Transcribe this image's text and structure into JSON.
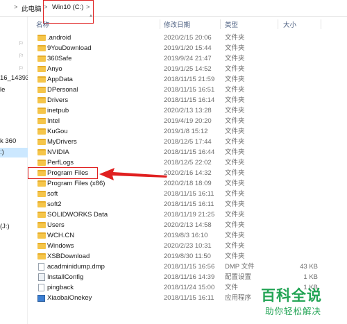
{
  "breadcrumb": {
    "chevron_left": ">",
    "computer": "此电脑",
    "chevron_mid": ">",
    "drive": "Win10 (C:)",
    "chevron_right": ">"
  },
  "nav": {
    "items": [
      {
        "label": "16_14393."
      },
      {
        "label": "le"
      },
      {
        "label": "k 360"
      },
      {
        "label": ":)"
      },
      {
        "label": "(J:)"
      }
    ]
  },
  "columns": {
    "name": "名称",
    "date": "修改日期",
    "type": "类型",
    "size": "大小"
  },
  "files": [
    {
      "name": ".android",
      "date": "2020/2/15 20:06",
      "type": "文件夹",
      "size": "",
      "icon": "folder-icon"
    },
    {
      "name": "9YouDownload",
      "date": "2019/1/20 15:44",
      "type": "文件夹",
      "size": "",
      "icon": "folder-icon"
    },
    {
      "name": "360Safe",
      "date": "2019/9/24 21:47",
      "type": "文件夹",
      "size": "",
      "icon": "folder-icon"
    },
    {
      "name": "Anyo",
      "date": "2019/1/25 14:52",
      "type": "文件夹",
      "size": "",
      "icon": "folder-icon"
    },
    {
      "name": "AppData",
      "date": "2018/11/15 21:59",
      "type": "文件夹",
      "size": "",
      "icon": "folder-icon"
    },
    {
      "name": "DPersonal",
      "date": "2018/11/15 16:51",
      "type": "文件夹",
      "size": "",
      "icon": "folder-icon"
    },
    {
      "name": "Drivers",
      "date": "2018/11/15 16:14",
      "type": "文件夹",
      "size": "",
      "icon": "folder-icon"
    },
    {
      "name": "inetpub",
      "date": "2020/2/13 13:28",
      "type": "文件夹",
      "size": "",
      "icon": "folder-icon"
    },
    {
      "name": "Intel",
      "date": "2019/4/19 20:20",
      "type": "文件夹",
      "size": "",
      "icon": "folder-icon"
    },
    {
      "name": "KuGou",
      "date": "2019/1/8 15:12",
      "type": "文件夹",
      "size": "",
      "icon": "folder-icon"
    },
    {
      "name": "MyDrivers",
      "date": "2018/12/5 17:44",
      "type": "文件夹",
      "size": "",
      "icon": "folder-icon"
    },
    {
      "name": "NVIDIA",
      "date": "2018/11/15 16:44",
      "type": "文件夹",
      "size": "",
      "icon": "folder-icon"
    },
    {
      "name": "PerfLogs",
      "date": "2018/12/5 22:02",
      "type": "文件夹",
      "size": "",
      "icon": "folder-icon"
    },
    {
      "name": "Program Files",
      "date": "2020/2/16 14:32",
      "type": "文件夹",
      "size": "",
      "icon": "folder-icon"
    },
    {
      "name": "Program Files (x86)",
      "date": "2020/2/18 18:09",
      "type": "文件夹",
      "size": "",
      "icon": "folder-icon"
    },
    {
      "name": "soft",
      "date": "2018/11/15 16:11",
      "type": "文件夹",
      "size": "",
      "icon": "folder-icon"
    },
    {
      "name": "soft2",
      "date": "2018/11/15 16:11",
      "type": "文件夹",
      "size": "",
      "icon": "folder-icon"
    },
    {
      "name": "SOLIDWORKS Data",
      "date": "2018/11/19 21:25",
      "type": "文件夹",
      "size": "",
      "icon": "folder-icon"
    },
    {
      "name": "Users",
      "date": "2020/2/13 14:58",
      "type": "文件夹",
      "size": "",
      "icon": "folder-icon"
    },
    {
      "name": "WCH.CN",
      "date": "2019/8/3 16:10",
      "type": "文件夹",
      "size": "",
      "icon": "folder-icon"
    },
    {
      "name": "Windows",
      "date": "2020/2/23 10:31",
      "type": "文件夹",
      "size": "",
      "icon": "folder-icon"
    },
    {
      "name": "XSBDownload",
      "date": "2019/8/30 11:50",
      "type": "文件夹",
      "size": "",
      "icon": "folder-icon"
    },
    {
      "name": "acadminidump.dmp",
      "date": "2018/11/15 16:56",
      "type": "DMP 文件",
      "size": "43 KB",
      "icon": "file-icon"
    },
    {
      "name": "InstallConfig",
      "date": "2018/11/16 14:39",
      "type": "配置设置",
      "size": "1 KB",
      "icon": "config-file-icon"
    },
    {
      "name": "pingback",
      "date": "2018/11/24 15:00",
      "type": "文件",
      "size": "1 KB",
      "icon": "file-icon"
    },
    {
      "name": "XiaobaiOnekey",
      "date": "2018/11/15 16:11",
      "type": "应用程序",
      "size": "",
      "icon": "application-icon"
    }
  ],
  "watermark": {
    "title": "百科全说",
    "subtitle": "助你轻松解决"
  },
  "colors": {
    "annotation_red": "#e02020",
    "folder_yellow": "#f5c54a",
    "watermark_green": "#23a455",
    "selection_blue": "#cce8ff"
  }
}
